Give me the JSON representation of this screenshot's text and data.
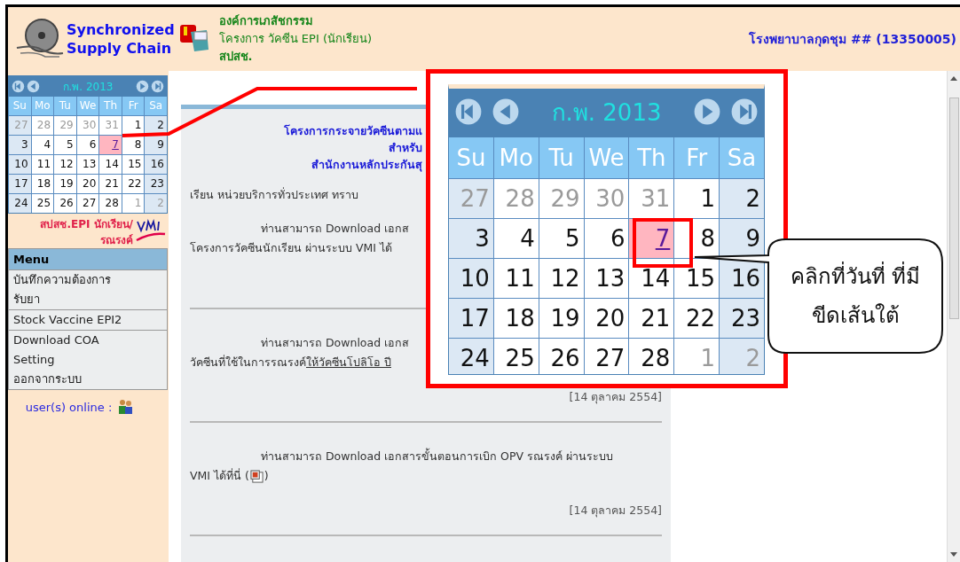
{
  "header": {
    "app_name_lines": [
      "Synchronized",
      "Supply Chain"
    ],
    "org_lines": [
      {
        "text": "องค์การเภสัชกรรม",
        "bold": true
      },
      {
        "text": "โครงการ วัคซีน EPI (นักเรียน)",
        "bold": false
      },
      {
        "text": "สปสช.",
        "bold": true
      }
    ],
    "hospital": "โรงพยาบาลกุดชุม ## (13350005)"
  },
  "sidebar": {
    "calendar": {
      "month_label": "ก.พ. 2013",
      "weekdays": [
        "Su",
        "Mo",
        "Tu",
        "We",
        "Th",
        "Fr",
        "Sa"
      ],
      "weeks": [
        [
          {
            "day": "27",
            "kind": "other",
            "selected": false
          },
          {
            "day": "28",
            "kind": "other",
            "selected": false
          },
          {
            "day": "29",
            "kind": "other",
            "selected": false
          },
          {
            "day": "30",
            "kind": "other",
            "selected": false
          },
          {
            "day": "31",
            "kind": "other",
            "selected": false
          },
          {
            "day": "1",
            "kind": "current",
            "selected": false
          },
          {
            "day": "2",
            "kind": "current",
            "selected": false
          }
        ],
        [
          {
            "day": "3",
            "kind": "current",
            "selected": false
          },
          {
            "day": "4",
            "kind": "current",
            "selected": false
          },
          {
            "day": "5",
            "kind": "current",
            "selected": false
          },
          {
            "day": "6",
            "kind": "current",
            "selected": false
          },
          {
            "day": "7",
            "kind": "current",
            "selected": true
          },
          {
            "day": "8",
            "kind": "current",
            "selected": false
          },
          {
            "day": "9",
            "kind": "current",
            "selected": false
          }
        ],
        [
          {
            "day": "10",
            "kind": "current",
            "selected": false
          },
          {
            "day": "11",
            "kind": "current",
            "selected": false
          },
          {
            "day": "12",
            "kind": "current",
            "selected": false
          },
          {
            "day": "13",
            "kind": "current",
            "selected": false
          },
          {
            "day": "14",
            "kind": "current",
            "selected": false
          },
          {
            "day": "15",
            "kind": "current",
            "selected": false
          },
          {
            "day": "16",
            "kind": "current",
            "selected": false
          }
        ],
        [
          {
            "day": "17",
            "kind": "current",
            "selected": false
          },
          {
            "day": "18",
            "kind": "current",
            "selected": false
          },
          {
            "day": "19",
            "kind": "current",
            "selected": false
          },
          {
            "day": "20",
            "kind": "current",
            "selected": false
          },
          {
            "day": "21",
            "kind": "current",
            "selected": false
          },
          {
            "day": "22",
            "kind": "current",
            "selected": false
          },
          {
            "day": "23",
            "kind": "current",
            "selected": false
          }
        ],
        [
          {
            "day": "24",
            "kind": "current",
            "selected": false
          },
          {
            "day": "25",
            "kind": "current",
            "selected": false
          },
          {
            "day": "26",
            "kind": "current",
            "selected": false
          },
          {
            "day": "27",
            "kind": "current",
            "selected": false
          },
          {
            "day": "28",
            "kind": "current",
            "selected": false
          },
          {
            "day": "1",
            "kind": "other",
            "selected": false
          },
          {
            "day": "2",
            "kind": "other",
            "selected": false
          }
        ]
      ]
    },
    "program_lines": [
      "สปสช.EPI นักเรียน/",
      "รณรงค์"
    ],
    "menu": {
      "title": "Menu",
      "groups": [
        [
          "บันทึกความต้องการ",
          "รับยา"
        ],
        [
          "Stock Vaccine EPI2"
        ],
        [
          "Download COA",
          "Setting",
          "ออกจากระบบ"
        ]
      ]
    },
    "online_label": "user(s) online :"
  },
  "content": {
    "title_lines": [
      "โครงการกระจายวัคซีนตามแ",
      "สำหรับ",
      "สำนักงานหลักประกันสุ"
    ],
    "greeting": "เรียน หน่วยบริการทั่วประเทศ ทราบ",
    "paragraphs": [
      {
        "lines": [
          "ท่านสามารถ Download เอกส",
          "โครงการวัคซีนนักเรียน ผ่านระบบ VMI ได้"
        ]
      },
      {
        "lines": [
          "ท่านสามารถ Download เอกส",
          "วัคซีนที่ใช้ในการรณรงค์"
        ],
        "link": "ให้วัคซีนโปลิโอ ปี",
        "date": "[14 ตุลาคม 2554]"
      },
      {
        "lines": [
          "ท่านสามารถ Download เอกสารขั้นตอนการเบิก OPV รณรงค์ ผ่านระบบ",
          "VMI ได้ที่นี่ ("
        ],
        "attachment": true,
        "closing": ")",
        "date": "[14 ตุลาคม 2554]"
      }
    ]
  },
  "zoom_calendar": {
    "month_label": "ก.พ. 2013",
    "weekdays": [
      "Su",
      "Mo",
      "Tu",
      "We",
      "Th",
      "Fr",
      "Sa"
    ],
    "weeks": [
      [
        {
          "day": "27",
          "kind": "other",
          "selected": false
        },
        {
          "day": "28",
          "kind": "other",
          "selected": false
        },
        {
          "day": "29",
          "kind": "other",
          "selected": false
        },
        {
          "day": "30",
          "kind": "other",
          "selected": false
        },
        {
          "day": "31",
          "kind": "other",
          "selected": false
        },
        {
          "day": "1",
          "kind": "current",
          "selected": false
        },
        {
          "day": "2",
          "kind": "current",
          "selected": false
        }
      ],
      [
        {
          "day": "3",
          "kind": "current",
          "selected": false
        },
        {
          "day": "4",
          "kind": "current",
          "selected": false
        },
        {
          "day": "5",
          "kind": "current",
          "selected": false
        },
        {
          "day": "6",
          "kind": "current",
          "selected": false
        },
        {
          "day": "7",
          "kind": "current",
          "selected": true
        },
        {
          "day": "8",
          "kind": "current",
          "selected": false
        },
        {
          "day": "9",
          "kind": "current",
          "selected": false
        }
      ],
      [
        {
          "day": "10",
          "kind": "current",
          "selected": false
        },
        {
          "day": "11",
          "kind": "current",
          "selected": false
        },
        {
          "day": "12",
          "kind": "current",
          "selected": false
        },
        {
          "day": "13",
          "kind": "current",
          "selected": false
        },
        {
          "day": "14",
          "kind": "current",
          "selected": false
        },
        {
          "day": "15",
          "kind": "current",
          "selected": false
        },
        {
          "day": "16",
          "kind": "current",
          "selected": false
        }
      ],
      [
        {
          "day": "17",
          "kind": "current",
          "selected": false
        },
        {
          "day": "18",
          "kind": "current",
          "selected": false
        },
        {
          "day": "19",
          "kind": "current",
          "selected": false
        },
        {
          "day": "20",
          "kind": "current",
          "selected": false
        },
        {
          "day": "21",
          "kind": "current",
          "selected": false
        },
        {
          "day": "22",
          "kind": "current",
          "selected": false
        },
        {
          "day": "23",
          "kind": "current",
          "selected": false
        }
      ],
      [
        {
          "day": "24",
          "kind": "current",
          "selected": false
        },
        {
          "day": "25",
          "kind": "current",
          "selected": false
        },
        {
          "day": "26",
          "kind": "current",
          "selected": false
        },
        {
          "day": "27",
          "kind": "current",
          "selected": false
        },
        {
          "day": "28",
          "kind": "current",
          "selected": false
        },
        {
          "day": "1",
          "kind": "other",
          "selected": false
        },
        {
          "day": "2",
          "kind": "other",
          "selected": false
        }
      ]
    ]
  },
  "callout": {
    "lines": [
      "คลิกที่วันที่ ที่มี",
      "ขีดเส้นใต้"
    ]
  }
}
